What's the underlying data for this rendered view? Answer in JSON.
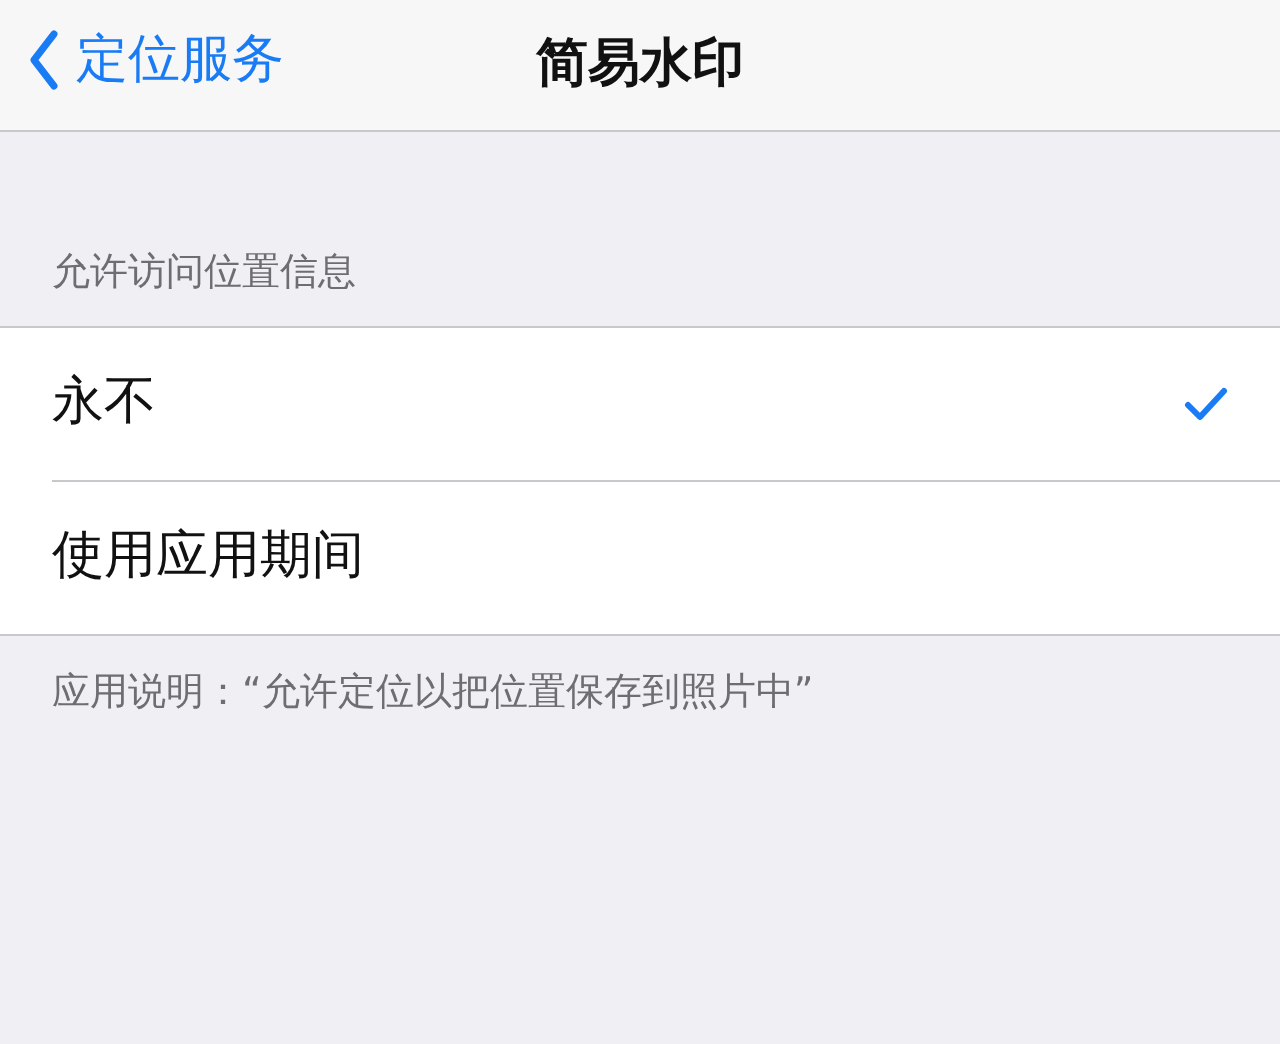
{
  "nav_bar": {
    "back_label": "定位服务",
    "title": "简易水印"
  },
  "section": {
    "header": "允许访问位置信息",
    "options": [
      {
        "label": "永不",
        "selected": true
      },
      {
        "label": "使用应用期间",
        "selected": false
      }
    ],
    "footer": "应用说明：“允许定位以把位置保存到照片中”"
  }
}
